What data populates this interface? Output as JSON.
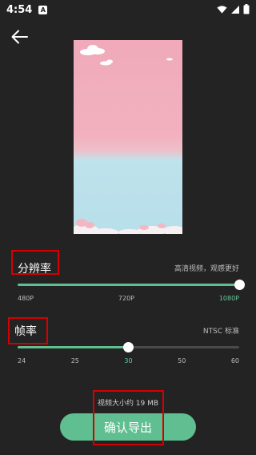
{
  "status_bar": {
    "time": "4:54",
    "notification_letter": "A"
  },
  "resolution": {
    "label": "分辨率",
    "hint": "高清视频，观感更好",
    "level_fraction": 1.0,
    "ticks": [
      "480P",
      "720P",
      "1080P"
    ],
    "selected": "1080P"
  },
  "frame_rate": {
    "label": "帧率",
    "hint": "NTSC 标准",
    "level_fraction": 0.5,
    "ticks": [
      "24",
      "25",
      "30",
      "50",
      "60"
    ],
    "selected": "30"
  },
  "export": {
    "size_text": "视频大小约 19 MB",
    "button_label": "确认导出"
  },
  "colors": {
    "accent": "#5fbf90",
    "background": "#232323",
    "highlight_box": "#d40000"
  }
}
